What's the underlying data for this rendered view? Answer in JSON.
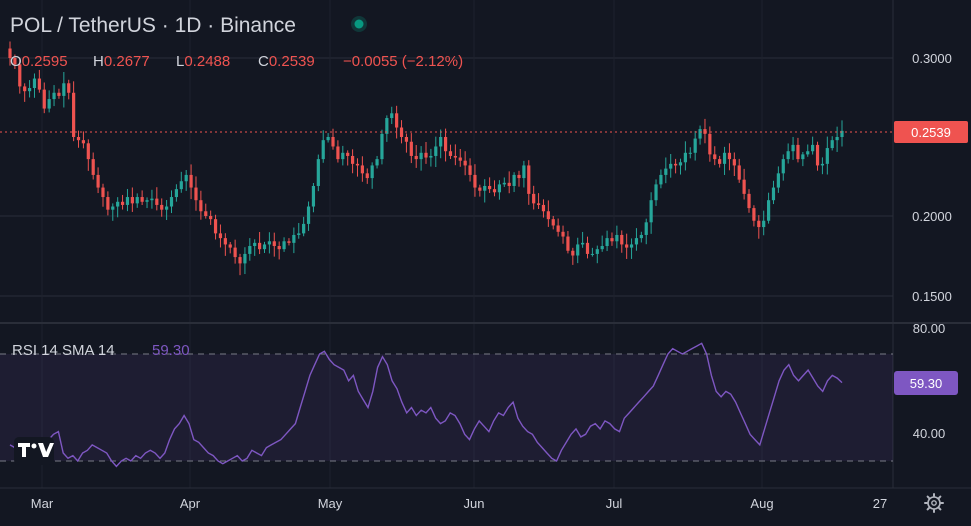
{
  "header": {
    "symbol": "POL / TetherUS · 1D · Binance",
    "status_dot_color": "#089981",
    "ohlc": [
      {
        "key": "O",
        "value": "0.2595"
      },
      {
        "key": "H",
        "value": "0.2677"
      },
      {
        "key": "L",
        "value": "0.2488"
      },
      {
        "key": "C",
        "value": "0.2539"
      }
    ],
    "change": "−0.0055 (−2.12%)"
  },
  "price_tag": "0.2539",
  "rsi": {
    "label": "RSI 14 SMA 14",
    "value": "59.30",
    "tag": "59.30",
    "color": "#7e57c2"
  },
  "colors": {
    "up": "#26a69a",
    "down": "#ef5350",
    "background": "#131722",
    "grid": "#2a2e39",
    "axis_text": "#d1d4dc",
    "header_text": "#d1d4dc"
  },
  "icons": {
    "logo": "tradingview-logo-icon",
    "settings": "gear-icon"
  },
  "chart_data": [
    {
      "type": "candlestick",
      "title": "POL / TetherUS · 1D · Binance",
      "y_ticks": [
        "0.3000",
        "0.2000",
        "0.1500"
      ],
      "x_ticks": [
        "Mar",
        "Apr",
        "May",
        "Jun",
        "Jul",
        "Aug",
        "27"
      ],
      "ylim": [
        0.14,
        0.32
      ],
      "last_close": 0.2539,
      "grid": true,
      "close_series": [
        0.3,
        0.296,
        0.282,
        0.279,
        0.281,
        0.287,
        0.28,
        0.268,
        0.274,
        0.278,
        0.276,
        0.284,
        0.278,
        0.25,
        0.248,
        0.246,
        0.236,
        0.226,
        0.218,
        0.212,
        0.204,
        0.206,
        0.209,
        0.207,
        0.212,
        0.208,
        0.212,
        0.209,
        0.21,
        0.211,
        0.207,
        0.204,
        0.206,
        0.212,
        0.217,
        0.222,
        0.226,
        0.218,
        0.21,
        0.203,
        0.2,
        0.198,
        0.189,
        0.186,
        0.182,
        0.18,
        0.174,
        0.17,
        0.176,
        0.181,
        0.183,
        0.179,
        0.182,
        0.184,
        0.181,
        0.179,
        0.184,
        0.183,
        0.188,
        0.189,
        0.195,
        0.206,
        0.219,
        0.236,
        0.248,
        0.25,
        0.244,
        0.236,
        0.24,
        0.238,
        0.233,
        0.232,
        0.227,
        0.224,
        0.232,
        0.236,
        0.252,
        0.262,
        0.265,
        0.256,
        0.25,
        0.247,
        0.238,
        0.236,
        0.24,
        0.237,
        0.238,
        0.244,
        0.25,
        0.241,
        0.238,
        0.237,
        0.235,
        0.232,
        0.226,
        0.218,
        0.216,
        0.219,
        0.217,
        0.215,
        0.22,
        0.221,
        0.219,
        0.226,
        0.224,
        0.232,
        0.214,
        0.208,
        0.207,
        0.203,
        0.198,
        0.194,
        0.19,
        0.187,
        0.178,
        0.175,
        0.182,
        0.183,
        0.176,
        0.176,
        0.179,
        0.181,
        0.186,
        0.184,
        0.188,
        0.182,
        0.18,
        0.182,
        0.186,
        0.188,
        0.196,
        0.21,
        0.22,
        0.226,
        0.23,
        0.233,
        0.232,
        0.234,
        0.24,
        0.24,
        0.249,
        0.255,
        0.252,
        0.239,
        0.236,
        0.233,
        0.24,
        0.236,
        0.232,
        0.223,
        0.214,
        0.205,
        0.197,
        0.193,
        0.197,
        0.21,
        0.218,
        0.227,
        0.236,
        0.241,
        0.245,
        0.236,
        0.239,
        0.241,
        0.245,
        0.232,
        0.233,
        0.243,
        0.248,
        0.25,
        0.2539
      ],
      "rsi_axis_ticks": [
        "80.00",
        "40.00"
      ],
      "rsi_ylim": [
        22,
        84
      ],
      "rsi_bands": [
        70,
        30
      ],
      "rsi_series": [
        36,
        35,
        34,
        36,
        32,
        31,
        35,
        36,
        38,
        40,
        41,
        33,
        31,
        32,
        30,
        33,
        34,
        36,
        35,
        34,
        33,
        30,
        28,
        30,
        31,
        30,
        32,
        31,
        33,
        34,
        33,
        31,
        33,
        38,
        42,
        44,
        47,
        44,
        38,
        37,
        35,
        33,
        32,
        30,
        29,
        30,
        31,
        32,
        30,
        31,
        34,
        33,
        32,
        35,
        36,
        37,
        38,
        40,
        42,
        44,
        50,
        56,
        62,
        66,
        70,
        71,
        68,
        66,
        65,
        64,
        60,
        62,
        56,
        53,
        50,
        56,
        65,
        69,
        66,
        60,
        57,
        52,
        48,
        50,
        47,
        49,
        48,
        50,
        46,
        44,
        45,
        48,
        47,
        44,
        40,
        38,
        42,
        45,
        43,
        41,
        45,
        48,
        47,
        50,
        52,
        46,
        43,
        41,
        40,
        37,
        35,
        33,
        31,
        30,
        34,
        37,
        40,
        42,
        39,
        40,
        43,
        44,
        42,
        45,
        44,
        42,
        41,
        46,
        48,
        50,
        52,
        54,
        56,
        58,
        62,
        66,
        70,
        72,
        71,
        70,
        71,
        72,
        73,
        74,
        70,
        62,
        56,
        54,
        56,
        55,
        52,
        48,
        44,
        40,
        38,
        36,
        42,
        48,
        54,
        60,
        64,
        66,
        62,
        60,
        62,
        64,
        61,
        58,
        56,
        60,
        62,
        61,
        59.3
      ]
    }
  ]
}
